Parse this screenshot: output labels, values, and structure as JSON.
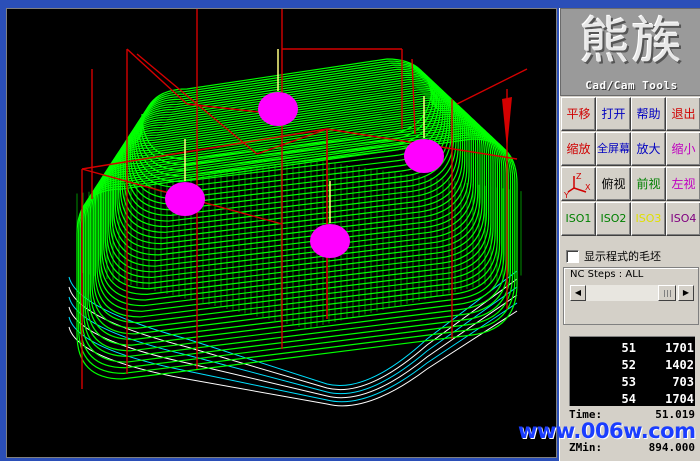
{
  "logo": {
    "chinese": "熊族",
    "english": "Cad/Cam Tools"
  },
  "buttons": [
    {
      "label": "平移",
      "color": "#d00000"
    },
    {
      "label": "打开",
      "color": "#0000c0"
    },
    {
      "label": "帮助",
      "color": "#0000c0"
    },
    {
      "label": "退出",
      "color": "#d00000"
    },
    {
      "label": "缩放",
      "color": "#d00000"
    },
    {
      "label": "全屏幕",
      "color": "#0000c0"
    },
    {
      "label": "放大",
      "color": "#0000c0"
    },
    {
      "label": "缩小",
      "color": "#c000c0"
    },
    {
      "label": "",
      "color": "#d00000",
      "icon": "axes-icon"
    },
    {
      "label": "俯视",
      "color": "#000000"
    },
    {
      "label": "前视",
      "color": "#008000"
    },
    {
      "label": "左视",
      "color": "#c000c0"
    },
    {
      "label": "ISO1",
      "color": "#008000"
    },
    {
      "label": "ISO2",
      "color": "#008000"
    },
    {
      "label": "ISO3",
      "color": "#e0e000"
    },
    {
      "label": "ISO4",
      "color": "#800080"
    }
  ],
  "show_stock_checkbox": {
    "label": "显示程式的毛坯",
    "checked": false
  },
  "nc_steps": {
    "label": "NC Steps : ALL"
  },
  "steps_table": [
    {
      "step": "51",
      "count": "1701"
    },
    {
      "step": "52",
      "count": "1402"
    },
    {
      "step": "53",
      "count": "703"
    },
    {
      "step": "54",
      "count": "1704"
    }
  ],
  "stats": {
    "time_label": "Time:",
    "time_value": "51.019",
    "zmin_label": "ZMin:",
    "zmin_value": "894.000"
  },
  "watermark": "www.006w.com",
  "colors": {
    "toolpath": "#00ff00",
    "rapid": "#d40000",
    "tool": "#ff00ff",
    "outline": "#00e0ff"
  }
}
